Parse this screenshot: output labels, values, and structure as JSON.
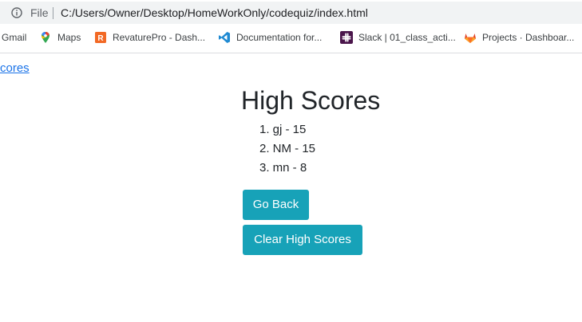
{
  "browser": {
    "file_label": "File",
    "url": "C:/Users/Owner/Desktop/HomeWorkOnly/codequiz/index.html",
    "bookmarks": [
      {
        "label": "Gmail",
        "icon": "gmail-icon"
      },
      {
        "label": "Maps",
        "icon": "maps-pin-icon"
      },
      {
        "label": "RevaturePro - Dash...",
        "icon": "revature-icon"
      },
      {
        "label": "Documentation for...",
        "icon": "vscode-icon"
      },
      {
        "label": "Slack | 01_class_acti...",
        "icon": "slack-icon"
      },
      {
        "label": "Projects · Dashboar...",
        "icon": "gitlab-icon"
      }
    ]
  },
  "page": {
    "nav_link": "cores",
    "title": "High Scores",
    "scores": [
      "1. gj - 15",
      "2. NM - 15",
      "3. mn - 8"
    ],
    "go_back_label": "Go Back",
    "clear_label": "Clear High Scores",
    "button_color": "#17a2b8",
    "link_color": "#1a73e8"
  }
}
